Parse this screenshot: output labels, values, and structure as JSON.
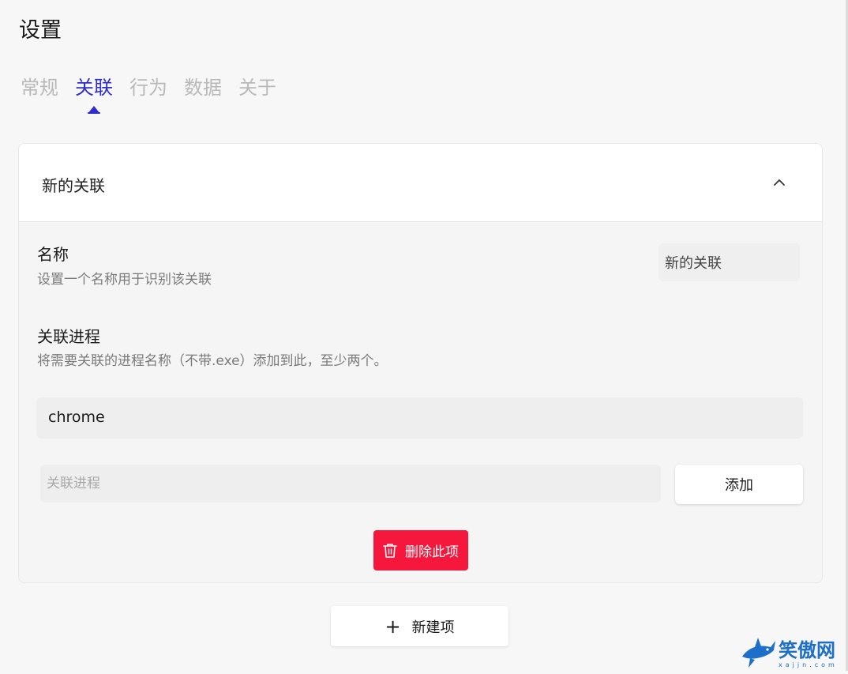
{
  "page": {
    "title": "设置"
  },
  "tabs": [
    {
      "label": "常规",
      "active": false
    },
    {
      "label": "关联",
      "active": true
    },
    {
      "label": "行为",
      "active": false
    },
    {
      "label": "数据",
      "active": false
    },
    {
      "label": "关于",
      "active": false
    }
  ],
  "card": {
    "title": "新的关联",
    "collapse_icon": "chevron-up-icon",
    "name_field": {
      "label": "名称",
      "description": "设置一个名称用于识别该关联",
      "value": "新的关联"
    },
    "process_field": {
      "label": "关联进程",
      "description": "将需要关联的进程名称（不带.exe）添加到此，至少两个。",
      "items": [
        "chrome"
      ],
      "input_placeholder": "关联进程",
      "add_label": "添加"
    },
    "delete_label": "删除此项",
    "delete_icon": "trash-icon"
  },
  "new_item": {
    "label": "新建项",
    "icon": "plus-icon"
  },
  "watermark": {
    "text": "笑傲网",
    "sub": "xajjn.com"
  },
  "colors": {
    "accent": "#2f2bd0",
    "danger": "#f5173c",
    "inactive_tab": "#b9b9b9"
  }
}
